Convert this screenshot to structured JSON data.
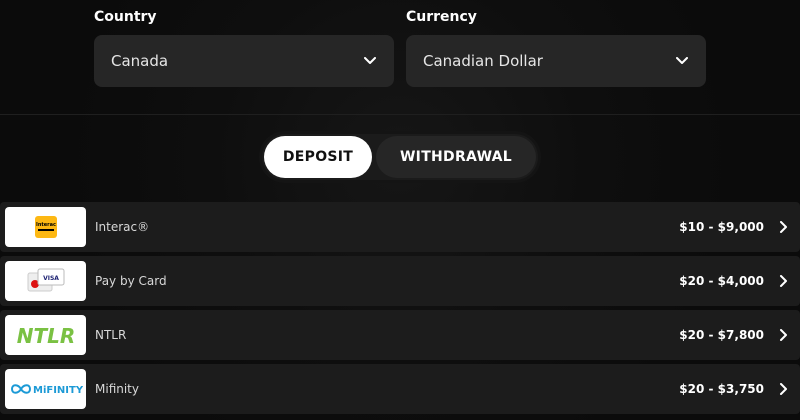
{
  "country": {
    "label": "Country",
    "value": "Canada"
  },
  "currency": {
    "label": "Currency",
    "value": "Canadian Dollar"
  },
  "tabs": {
    "deposit": "DEPOSIT",
    "withdrawal": "WITHDRAWAL",
    "active": "deposit"
  },
  "methods": [
    {
      "name": "Interac®",
      "range": "$10 - $9,000",
      "logo": "interac-logo",
      "logo_text": "Interac",
      "color": "#fdb813"
    },
    {
      "name": "Pay by Card",
      "range": "$20 - $4,000",
      "logo": "card-logo",
      "logo_text": "VISA",
      "color": "#1a1f71"
    },
    {
      "name": "NTLR",
      "range": "$20 - $7,800",
      "logo": "ntlr-logo",
      "logo_text": "NTLR",
      "color": "#7ac143"
    },
    {
      "name": "Mifinity",
      "range": "$20 - $3,750",
      "logo": "mifinity-logo",
      "logo_text": "MiFINITY",
      "color": "#1c9ad6"
    }
  ],
  "colors": {
    "background": "#0b0b0b",
    "row": "#1c1c1c",
    "select": "#262626"
  },
  "icons": {
    "dropdown": "chevron-down-icon",
    "row": "chevron-right-icon"
  }
}
